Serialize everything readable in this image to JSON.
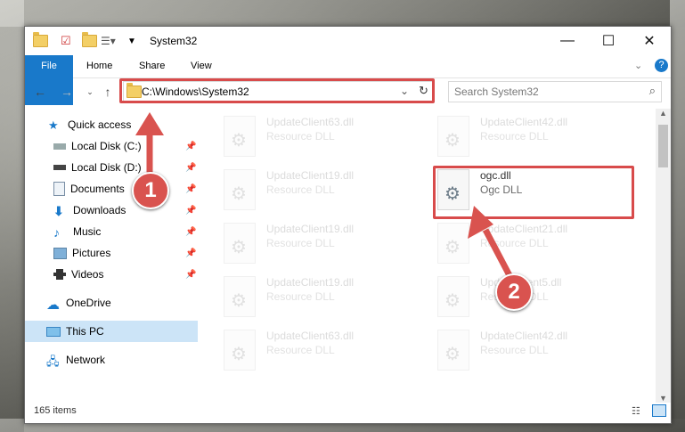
{
  "window": {
    "title": "System32"
  },
  "ribbon": {
    "tabs": [
      "File",
      "Home",
      "Share",
      "View"
    ]
  },
  "address": {
    "path": "C:\\Windows\\System32",
    "search_placeholder": "Search System32"
  },
  "nav": [
    {
      "label": "Quick access",
      "icon": "star-icon"
    },
    {
      "label": "Local Disk (C:)",
      "icon": "drive-icon"
    },
    {
      "label": "Local Disk (D:)",
      "icon": "drive-icon"
    },
    {
      "label": "Documents",
      "icon": "documents-icon"
    },
    {
      "label": "Downloads",
      "icon": "download-icon"
    },
    {
      "label": "Music",
      "icon": "music-icon"
    },
    {
      "label": "Pictures",
      "icon": "pictures-icon"
    },
    {
      "label": "Videos",
      "icon": "videos-icon"
    },
    {
      "label": "OneDrive",
      "icon": "cloud-icon"
    },
    {
      "label": "This PC",
      "icon": "pc-icon"
    },
    {
      "label": "Network",
      "icon": "network-icon"
    }
  ],
  "files": [
    {
      "name": "UpdateClient63.dll",
      "type": "Resource DLL"
    },
    {
      "name": "UpdateClient42.dll",
      "type": "Resource DLL"
    },
    {
      "name": "UpdateClient19.dll",
      "type": "Resource DLL"
    },
    {
      "name": "ogc.dll",
      "type": "Ogc DLL"
    },
    {
      "name": "UpdateClient19.dll",
      "type": "Resource DLL"
    },
    {
      "name": "UpdateClient21.dll",
      "type": "Resource DLL"
    },
    {
      "name": "UpdateClient19.dll",
      "type": "Resource DLL"
    },
    {
      "name": "UpdateClient5.dll",
      "type": "Resource DLL"
    },
    {
      "name": "UpdateClient63.dll",
      "type": "Resource DLL"
    },
    {
      "name": "UpdateClient42.dll",
      "type": "Resource DLL"
    }
  ],
  "status": {
    "items": "165 items"
  },
  "annotations": {
    "badge1": "1",
    "badge2": "2"
  },
  "colors": {
    "accent": "#1979ca",
    "highlight": "#d84b4b",
    "selected": "#cce4f7"
  }
}
